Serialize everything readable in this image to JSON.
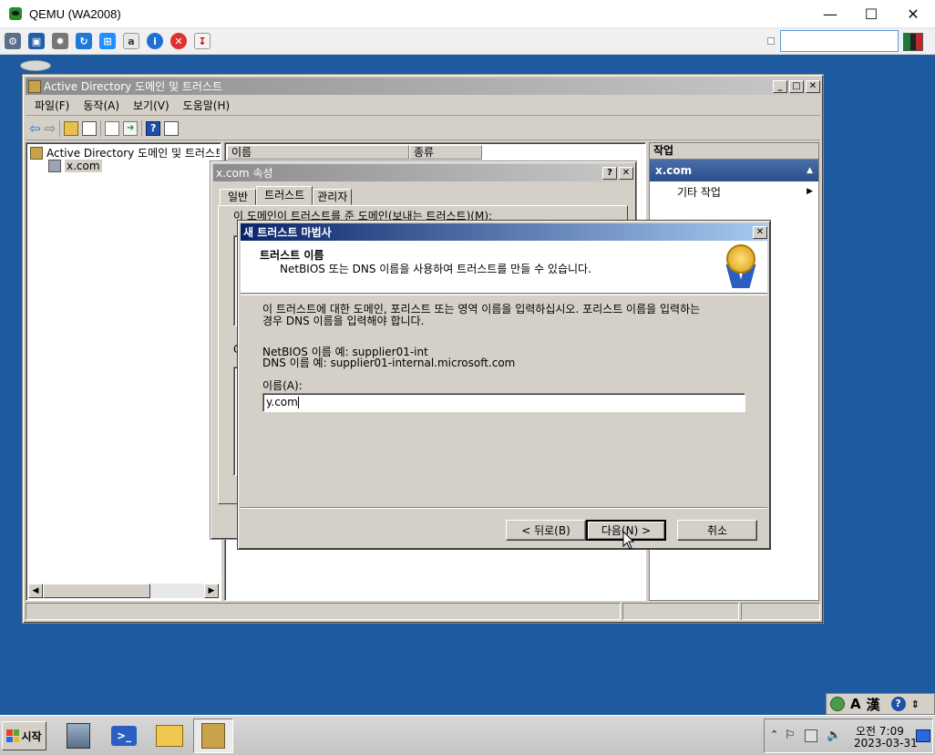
{
  "host": {
    "title": "QEMU (WA2008)",
    "minimize": "—",
    "maximize": "☐",
    "close": "✕"
  },
  "ad_window": {
    "title": "Active Directory 도메인 및 트러스트",
    "menu": [
      "파일(F)",
      "동작(A)",
      "보기(V)",
      "도움말(H)"
    ],
    "tree_root": "Active Directory 도메인 및 트러스트",
    "tree_child": "x.com",
    "list_columns": [
      "이름",
      "종류"
    ],
    "actions_header": "작업",
    "actions_domain": "x.com",
    "actions_more": "기타 작업"
  },
  "props_dialog": {
    "title": "x.com 속성",
    "tabs": [
      "일반",
      "트러스트",
      "관리자"
    ],
    "outgoing_label": "이 도메인이 트러스트를 준 도메인(보내는 트러스트)(M):",
    "partial_label": "C"
  },
  "wizard": {
    "title": "새 트러스트 마법사",
    "heading": "트러스트 이름",
    "subheading": "NetBIOS 또는 DNS 이름을 사용하여 트러스트를 만들 수 있습니다.",
    "instruction_line1": "이 트러스트에 대한 도메인, 포리스트 또는 영역 이름을 입력하십시오. 포리스트 이름을 입력하는",
    "instruction_line2": "경우 DNS 이름을 입력해야 합니다.",
    "example_netbios": "NetBIOS 이름 예: supplier01-int",
    "example_dns": "DNS 이름 예: supplier01-internal.microsoft.com",
    "name_label": "이름(A):",
    "name_value": "y.com",
    "back_button": "< 뒤로(B)",
    "next_button": "다음(N) >",
    "cancel_button": "취소"
  },
  "taskbar": {
    "start": "시작",
    "clock_time": "오전 7:09",
    "clock_date": "2023-03-31",
    "ime_mode": "A",
    "ime_hanja": "漢"
  }
}
